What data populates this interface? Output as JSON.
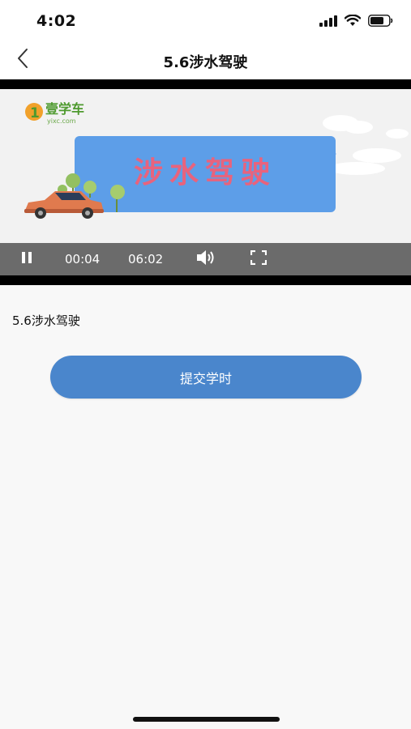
{
  "status_bar": {
    "time": "4:02"
  },
  "nav": {
    "title": "5.6涉水驾驶"
  },
  "video": {
    "logo_text": "壹学车",
    "logo_url": "yixc.com",
    "banner_title": "涉水驾驶",
    "current_time": "00:04",
    "duration": "06:02"
  },
  "content": {
    "lesson_title": "5.6涉水驾驶",
    "submit_label": "提交学时"
  },
  "colors": {
    "accent": "#4a86cc",
    "banner_blue": "#5d9ee8",
    "banner_text": "#e8637d",
    "controls_bg": "#6b6b6b"
  },
  "icons": [
    "back-arrow-icon",
    "signal-icon",
    "wifi-icon",
    "battery-icon",
    "pause-icon",
    "volume-icon",
    "fullscreen-icon"
  ]
}
